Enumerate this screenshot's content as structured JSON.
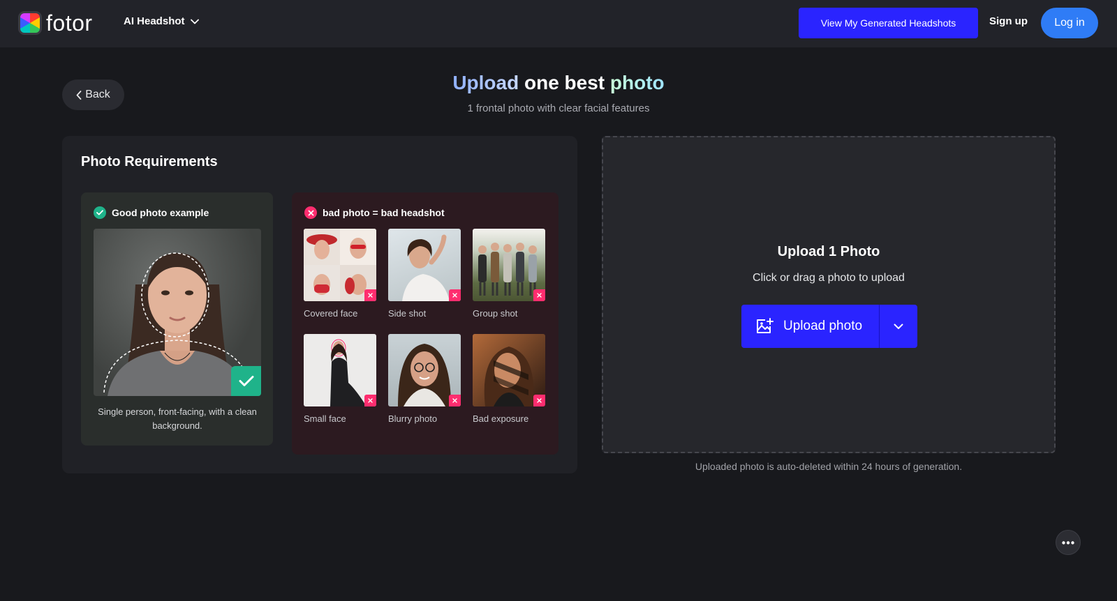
{
  "header": {
    "logo_text": "fotor",
    "product_menu": "AI Headshot",
    "view_generated": "View My Generated Headshots",
    "signup": "Sign up",
    "login": "Log in"
  },
  "nav": {
    "back": "Back"
  },
  "page": {
    "title_part1": "Upload",
    "title_part2": " one best ",
    "title_part3": "photo",
    "subtitle": "1 frontal photo with clear facial features"
  },
  "requirements": {
    "title": "Photo Requirements",
    "good": {
      "heading": "Good photo example",
      "caption": "Single person, front-facing, with a clean background."
    },
    "bad": {
      "heading": "bad photo = bad headshot",
      "items": [
        {
          "label": "Covered face"
        },
        {
          "label": "Side shot"
        },
        {
          "label": "Group shot"
        },
        {
          "label": "Small face"
        },
        {
          "label": "Blurry photo"
        },
        {
          "label": "Bad exposure"
        }
      ]
    }
  },
  "upload": {
    "title": "Upload 1 Photo",
    "subtitle": "Click or drag a photo to upload",
    "button": "Upload photo",
    "note": "Uploaded photo is auto-deleted within 24 hours of generation."
  },
  "colors": {
    "primary": "#2a24ff",
    "login": "#2f7cf6",
    "good": "#1fb38a",
    "bad": "#ff2d6f"
  },
  "icons": [
    "chevron-down-icon",
    "chevron-left-icon",
    "check-circle-icon",
    "x-circle-icon",
    "image-add-icon",
    "more-icon"
  ]
}
